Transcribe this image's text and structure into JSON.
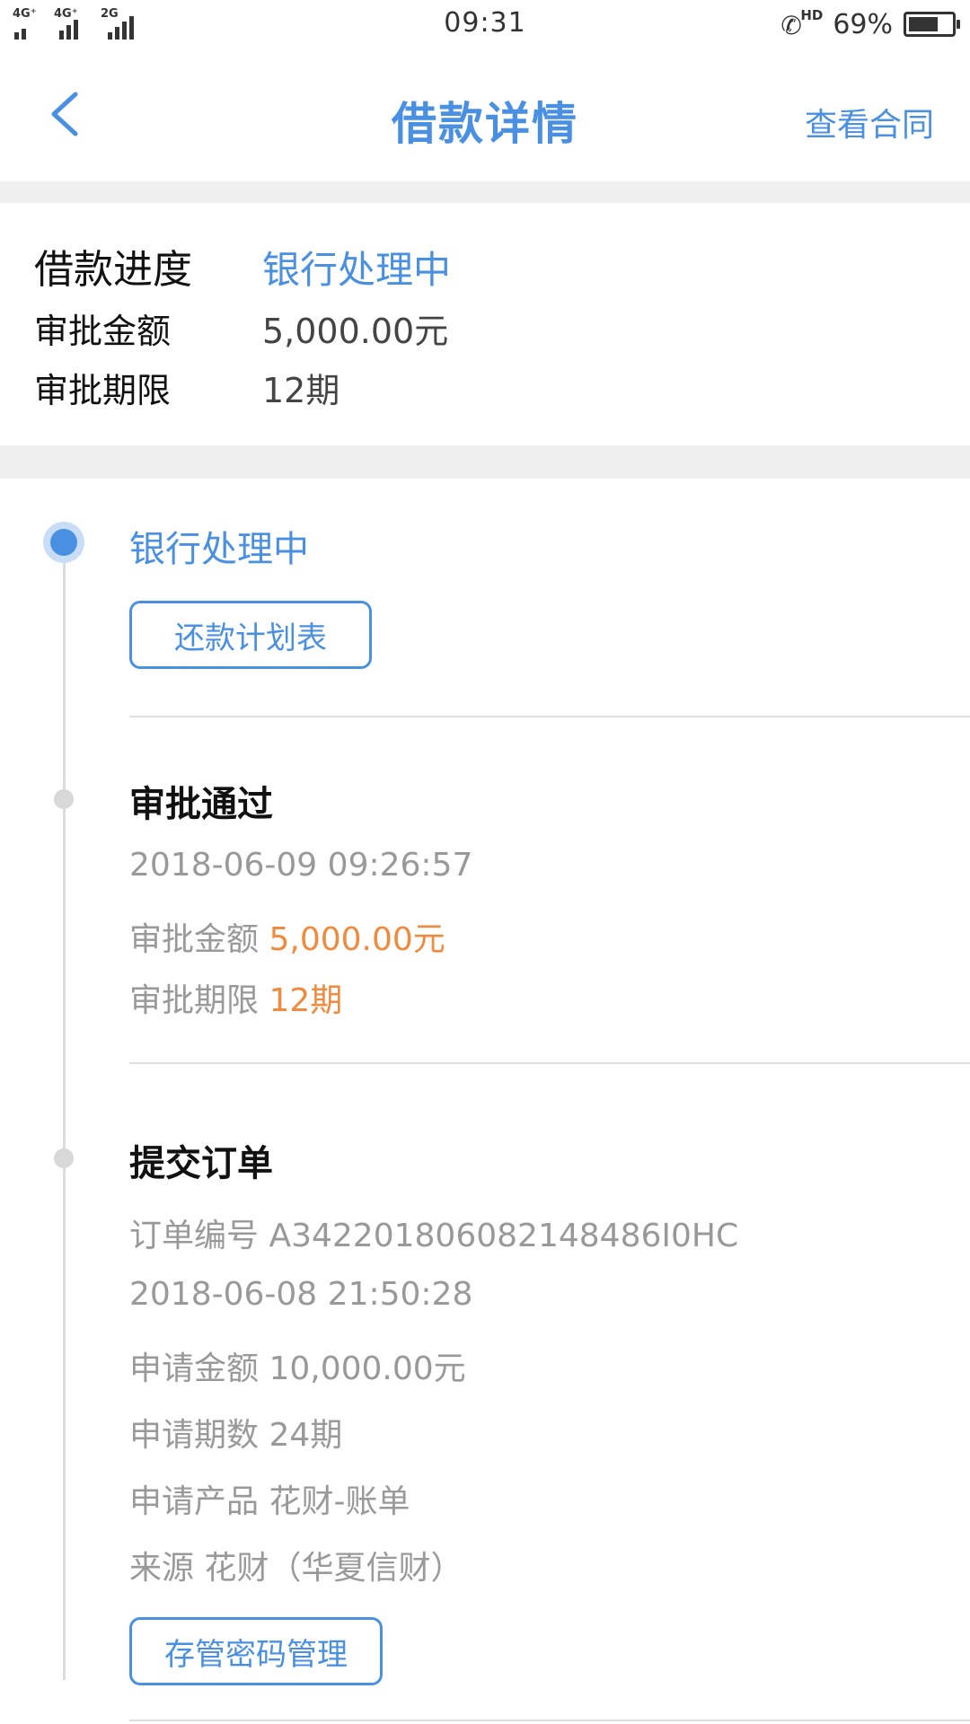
{
  "status_bar": {
    "network_1": "4G⁺",
    "network_2": "4G⁺",
    "network_3": "2G",
    "time": "09:31",
    "hd_label": "HD",
    "battery_percent": "69%",
    "battery_level": 0.69
  },
  "nav": {
    "back_icon": "chevron-left-icon",
    "title": "借款详情",
    "contract_link": "查看合同"
  },
  "summary": {
    "progress_label": "借款进度",
    "progress_value": "银行处理中",
    "amount_label": "审批金额",
    "amount_value": "5,000.00元",
    "term_label": "审批期限",
    "term_value": "12期"
  },
  "timeline": {
    "step1": {
      "title": "银行处理中",
      "button": "还款计划表"
    },
    "step2": {
      "title": "审批通过",
      "time": "2018-06-09 09:26:57",
      "amount_label": "审批金额",
      "amount_value": "5,000.00元",
      "term_label": "审批期限",
      "term_value": "12期"
    },
    "step3": {
      "title": "提交订单",
      "order_label": "订单编号",
      "order_value": "A342201806082148486I0HC",
      "time": "2018-06-08 21:50:28",
      "apply_amount_label": "申请金额",
      "apply_amount_value": "10,000.00元",
      "apply_term_label": "申请期数",
      "apply_term_value": "24期",
      "product_label": "申请产品",
      "product_value": "花财-账单",
      "source_label": "来源",
      "source_value": "花财（华夏信财）",
      "button": "存管密码管理"
    }
  },
  "colors": {
    "accent": "#4a90e2",
    "highlight": "#f08a3c",
    "muted_text": "#999999",
    "band": "#efefef"
  }
}
